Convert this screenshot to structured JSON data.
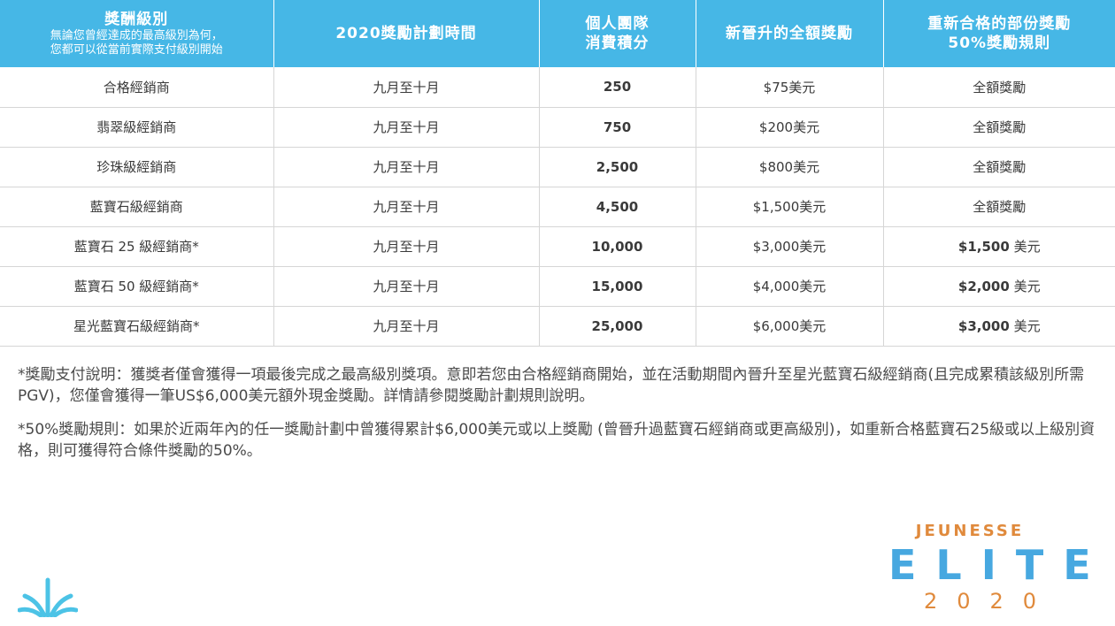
{
  "table": {
    "headers": {
      "level_title": "獎酬級別",
      "level_sub": [
        "無論您曾經達成的最高級別為何，",
        "您都可以從當前實際支付級別開始"
      ],
      "period": "2020獎勵計劃時間",
      "points": [
        "個人團隊",
        "消費積分"
      ],
      "full_reward": "新晉升的全額獎勵",
      "partial_reward": [
        "重新合格的部份獎勵",
        "50%獎勵規則"
      ]
    },
    "rows": [
      {
        "level": "合格經銷商",
        "period": "九月至十月",
        "points": "250",
        "full": "$75美元",
        "partial_amount": "",
        "partial_text": "全額獎勵"
      },
      {
        "level": "翡翠級經銷商",
        "period": "九月至十月",
        "points": "750",
        "full": "$200美元",
        "partial_amount": "",
        "partial_text": "全額獎勵"
      },
      {
        "level": "珍珠級經銷商",
        "period": "九月至十月",
        "points": "2,500",
        "full": "$800美元",
        "partial_amount": "",
        "partial_text": "全額獎勵"
      },
      {
        "level": "藍寶石級經銷商",
        "period": "九月至十月",
        "points": "4,500",
        "full": "$1,500美元",
        "partial_amount": "",
        "partial_text": "全額獎勵"
      },
      {
        "level": "藍寶石 25 級經銷商*",
        "period": "九月至十月",
        "points": "10,000",
        "full": "$3,000美元",
        "partial_amount": "$1,500",
        "partial_text": " 美元"
      },
      {
        "level": "藍寶石 50 級經銷商*",
        "period": "九月至十月",
        "points": "15,000",
        "full": "$4,000美元",
        "partial_amount": "$2,000",
        "partial_text": " 美元"
      },
      {
        "level": "星光藍寶石級經銷商*",
        "period": "九月至十月",
        "points": "25,000",
        "full": "$6,000美元",
        "partial_amount": "$3,000",
        "partial_text": " 美元"
      }
    ]
  },
  "notes": {
    "payment_note": "*獎勵支付說明：獲獎者僅會獲得一項最後完成之最高級別獎項。意即若您由合格經銷商開始，並在活動期間內晉升至星光藍寶石級經銷商(且完成累積該級別所需PGV)，您僅會獲得一筆US$6,000美元額外現金獎勵。詳情請參閱獎勵計劃規則說明。",
    "rule_note": "*50%獎勵規則：如果於近兩年內的任一獎勵計劃中曾獲得累計$6,000美元或以上獎勵 (曾晉升過藍寶石經銷商或更高級別)，如重新合格藍寶石25級或以上級別資格，則可獲得符合條件獎勵的50%。"
  },
  "branding": {
    "brand_name": "JEUNESSE",
    "program": "ELITE",
    "year": "2020",
    "left_logo_icon": "jeunesse-leaf-icon",
    "colors": {
      "header_blue": "#46b7e6",
      "brand_orange": "#e08a3c",
      "elite_blue": "#47a8e0"
    }
  }
}
